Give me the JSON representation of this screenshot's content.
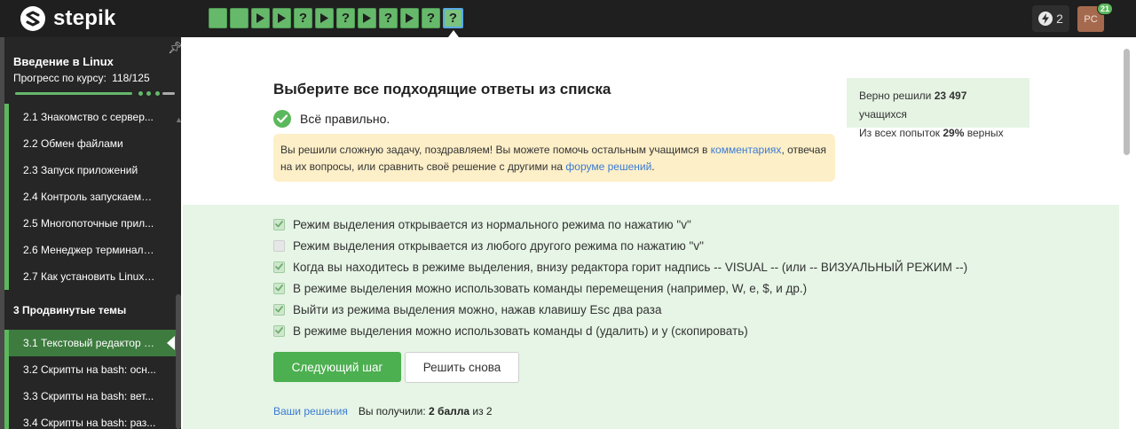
{
  "header": {
    "logo_text": "stepik",
    "steps": [
      {
        "kind": "theory"
      },
      {
        "kind": "theory"
      },
      {
        "kind": "video"
      },
      {
        "kind": "video"
      },
      {
        "kind": "quiz",
        "label": "?"
      },
      {
        "kind": "video"
      },
      {
        "kind": "quiz",
        "label": "?"
      },
      {
        "kind": "video"
      },
      {
        "kind": "quiz",
        "label": "?"
      },
      {
        "kind": "video"
      },
      {
        "kind": "quiz",
        "label": "?"
      },
      {
        "kind": "quiz",
        "label": "?",
        "current": true
      }
    ],
    "energy_count": "2",
    "avatar_initials": "PC",
    "notifications": "21"
  },
  "sidebar": {
    "course_title": "Введение в Linux",
    "progress_label": "Прогресс по курсу:",
    "progress_value": "118/125",
    "progress_fraction": 0.944,
    "lessons_top": [
      {
        "label": "2.1  Знакомство с сервер..."
      },
      {
        "label": "2.2  Обмен файлами"
      },
      {
        "label": "2.3  Запуск приложений"
      },
      {
        "label": "2.4  Контроль запускаемы..."
      },
      {
        "label": "2.5  Многопоточные прил..."
      },
      {
        "label": "2.6  Менеджер терминало..."
      },
      {
        "label": "2.7  Как установить Linux: ..."
      }
    ],
    "section_title": "3  Продвинутые темы",
    "lessons_bottom": [
      {
        "label": "3.1  Текстовый редактор v...",
        "active": true
      },
      {
        "label": "3.2  Скрипты на bash: осн..."
      },
      {
        "label": "3.3  Скрипты на bash: вет..."
      },
      {
        "label": "3.4  Скрипты на bash: раз..."
      }
    ]
  },
  "main": {
    "question_title": "Выберите все подходящие ответы из списка",
    "correct_text": "Всё правильно.",
    "hint": {
      "part1": "Вы решили сложную задачу, поздравляем! Вы можете помочь остальным учащимся в ",
      "link1": "комментариях",
      "part2": ", отвечая на их вопросы, или сравнить своё решение с другими на ",
      "link2": "форуме решений",
      "part3": "."
    },
    "stats": {
      "line1_prefix": "Верно решили ",
      "line1_value": "23 497",
      "line1_suffix": " учащихся",
      "line2_prefix": "Из всех попыток ",
      "line2_value": "29%",
      "line2_suffix": " верных"
    },
    "options": [
      {
        "text": "Режим выделения открывается из нормального режима по нажатию \"v\"",
        "checked": true
      },
      {
        "text": "Режим выделения открывается из любого другого режима по нажатию \"v\"",
        "checked": false
      },
      {
        "text": "Когда вы находитесь в режиме выделения, внизу редактора горит надпись -- VISUAL -- (или -- ВИЗУАЛЬНЫЙ РЕЖИМ --)",
        "checked": true
      },
      {
        "text": "В режиме выделения можно использовать команды перемещения (например, W, e, $, и др.)",
        "checked": true
      },
      {
        "text": "Выйти из режима выделения можно, нажав клавишу Esc два раза",
        "checked": true
      },
      {
        "text": "В режиме выделения можно использовать команды d (удалить) и y (скопировать)",
        "checked": true
      }
    ],
    "next_button": "Следующий шаг",
    "retry_button": "Решить снова",
    "footer": {
      "your_solutions": "Ваши решения",
      "score_prefix": "Вы получили: ",
      "score_value": "2 балла",
      "score_suffix": " из 2"
    }
  },
  "colors": {
    "accent_green": "#4caf50",
    "link_blue": "#3a7bd5",
    "topbar": "#1f1f1f",
    "sidebar": "#262626",
    "hint_bg": "#fdefc8",
    "answers_bg": "#e6f5e5"
  }
}
